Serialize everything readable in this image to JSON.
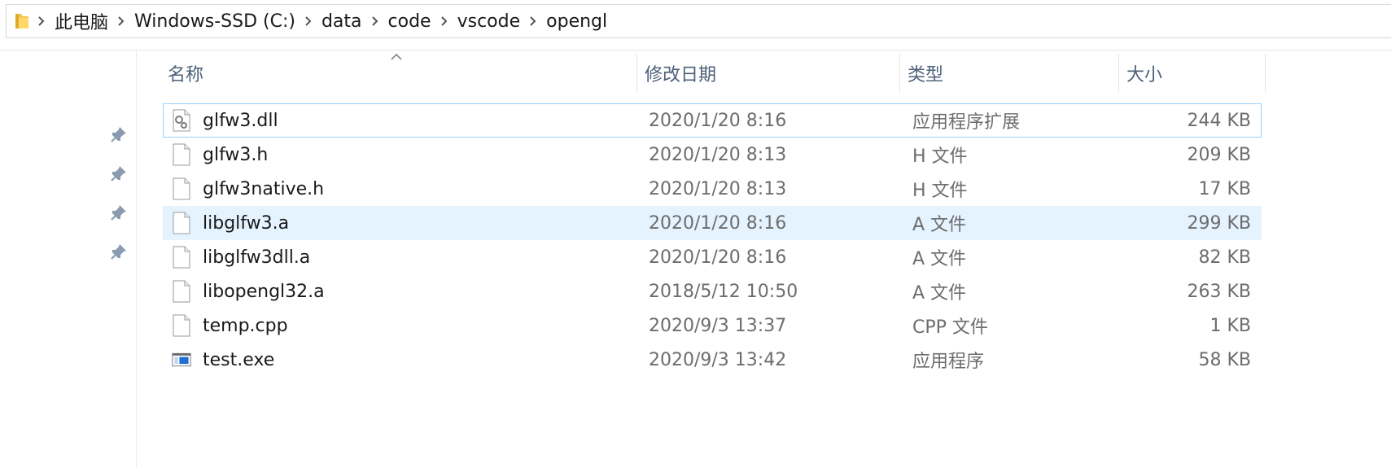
{
  "breadcrumb": {
    "items": [
      "此电脑",
      "Windows-SSD (C:)",
      "data",
      "code",
      "vscode",
      "opengl"
    ]
  },
  "columns": {
    "name": "名称",
    "modified": "修改日期",
    "type": "类型",
    "size": "大小"
  },
  "files": [
    {
      "name": "glfw3.dll",
      "modified": "2020/1/20 8:16",
      "type": "应用程序扩展",
      "size": "244 KB",
      "icon": "dll-gear-icon"
    },
    {
      "name": "glfw3.h",
      "modified": "2020/1/20 8:13",
      "type": "H 文件",
      "size": "209 KB",
      "icon": "blank-file-icon"
    },
    {
      "name": "glfw3native.h",
      "modified": "2020/1/20 8:13",
      "type": "H 文件",
      "size": "17 KB",
      "icon": "blank-file-icon"
    },
    {
      "name": "libglfw3.a",
      "modified": "2020/1/20 8:16",
      "type": "A 文件",
      "size": "299 KB",
      "icon": "blank-file-icon"
    },
    {
      "name": "libglfw3dll.a",
      "modified": "2020/1/20 8:16",
      "type": "A 文件",
      "size": "82 KB",
      "icon": "blank-file-icon"
    },
    {
      "name": "libopengl32.a",
      "modified": "2018/5/12 10:50",
      "type": "A 文件",
      "size": "263 KB",
      "icon": "blank-file-icon"
    },
    {
      "name": "temp.cpp",
      "modified": "2020/9/3 13:37",
      "type": "CPP 文件",
      "size": "1 KB",
      "icon": "blank-file-icon"
    },
    {
      "name": "test.exe",
      "modified": "2020/9/3 13:42",
      "type": "应用程序",
      "size": "58 KB",
      "icon": "exe-window-icon"
    }
  ],
  "colors": {
    "header_text": "#4c607a",
    "hover_bg": "#e5f3ff",
    "focus_border": "#99d1ff",
    "folder_yellow": "#f4c84f"
  }
}
